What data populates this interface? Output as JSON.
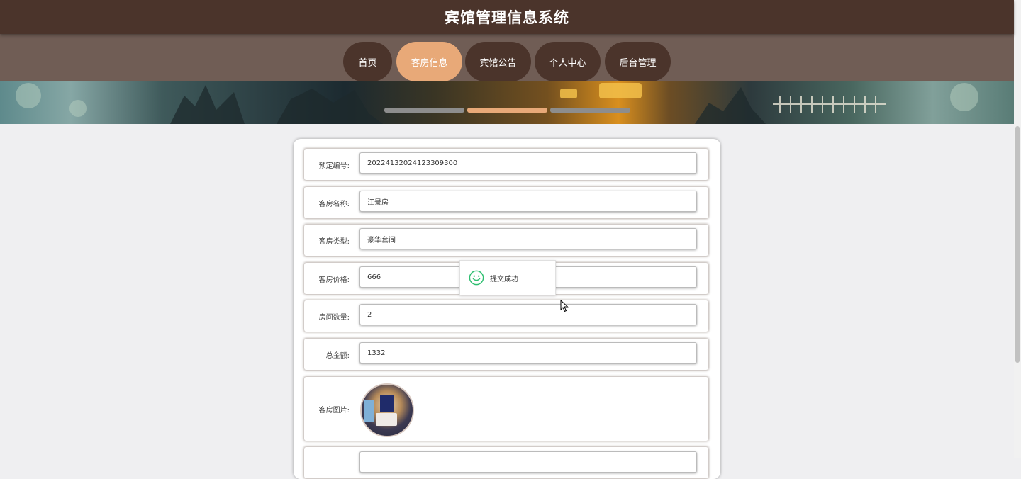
{
  "app": {
    "title": "宾馆管理信息系统"
  },
  "nav": {
    "items": [
      {
        "label": "首页",
        "active": false
      },
      {
        "label": "客房信息",
        "active": true
      },
      {
        "label": "宾馆公告",
        "active": false
      },
      {
        "label": "个人中心",
        "active": false
      },
      {
        "label": "后台管理",
        "active": false
      }
    ]
  },
  "carousel": {
    "slide_count": 3,
    "active_index": 1
  },
  "form": {
    "fields": [
      {
        "label": "预定编号:",
        "value": "20224132024123309300"
      },
      {
        "label": "客房名称:",
        "value": "江景房"
      },
      {
        "label": "客房类型:",
        "value": "豪华套间"
      },
      {
        "label": "客房价格:",
        "value": "666"
      },
      {
        "label": "房间数量:",
        "value": "2"
      },
      {
        "label": "总金额:",
        "value": "1332"
      }
    ],
    "image_label": "客房图片:"
  },
  "toast": {
    "message": "提交成功",
    "icon": "smile-icon"
  },
  "colors": {
    "header_bg": "#4b342b",
    "nav_bg": "#705d55",
    "accent": "#e8a978",
    "success": "#2fbf71"
  }
}
